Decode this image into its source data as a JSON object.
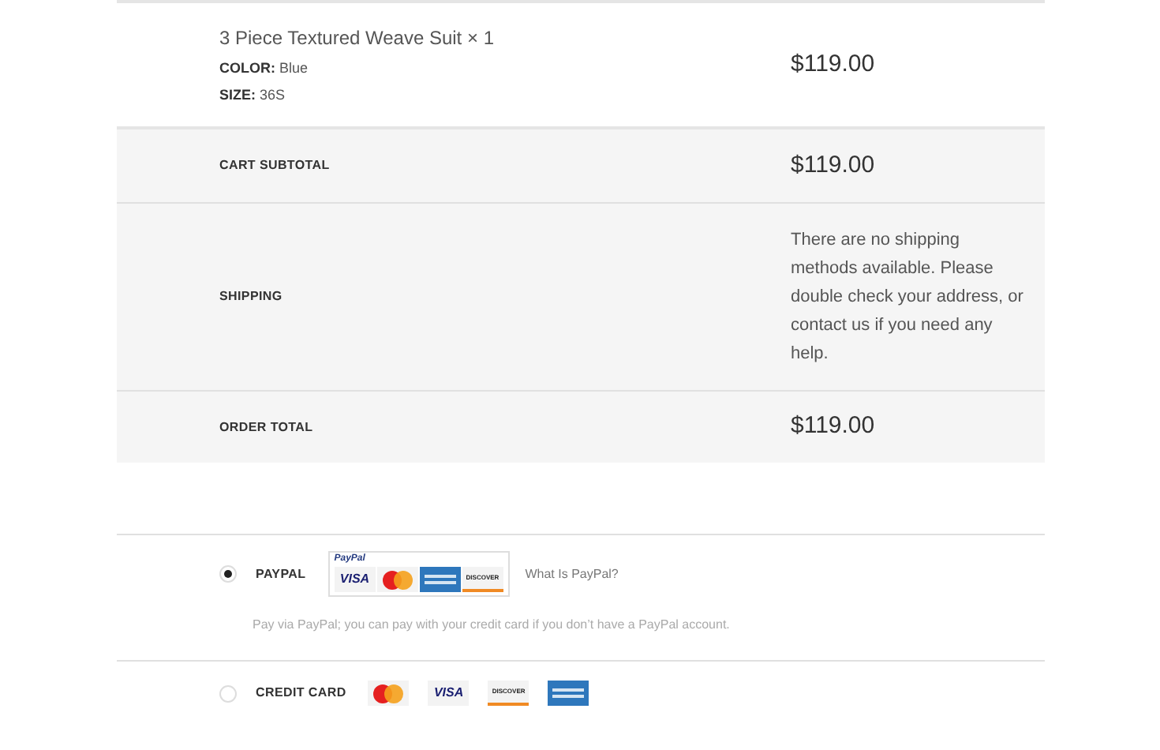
{
  "item": {
    "name": "3 Piece Textured Weave Suit",
    "quantity": "× 1",
    "meta": [
      {
        "label": "COLOR:",
        "value": "Blue"
      },
      {
        "label": "SIZE:",
        "value": "36S"
      }
    ],
    "price": "$119.00"
  },
  "totals": [
    {
      "label": "CART SUBTOTAL",
      "value": "$119.00"
    },
    {
      "label": "SHIPPING",
      "value": "There are no shipping methods available. Please double check your address, or contact us if you need any help."
    },
    {
      "label": "ORDER TOTAL",
      "value": "$119.00"
    }
  ],
  "payment_methods": [
    {
      "label": "PAYPAL",
      "selected": true,
      "badge": {
        "brand": "PayPal",
        "cards": [
          {
            "kind": "visa",
            "text": "VISA"
          },
          {
            "kind": "mastercard"
          },
          {
            "kind": "amex"
          },
          {
            "kind": "discover",
            "text": "DISCOVER"
          }
        ]
      },
      "link": "What Is PayPal?",
      "description": "Pay via PayPal; you can pay with your credit card if you don’t have a PayPal account."
    },
    {
      "label": "CREDIT CARD",
      "selected": false,
      "cards": [
        {
          "kind": "mastercard"
        },
        {
          "kind": "visa",
          "text": "VISA"
        },
        {
          "kind": "discover",
          "text": "DISCOVER"
        },
        {
          "kind": "amex"
        }
      ]
    }
  ]
}
